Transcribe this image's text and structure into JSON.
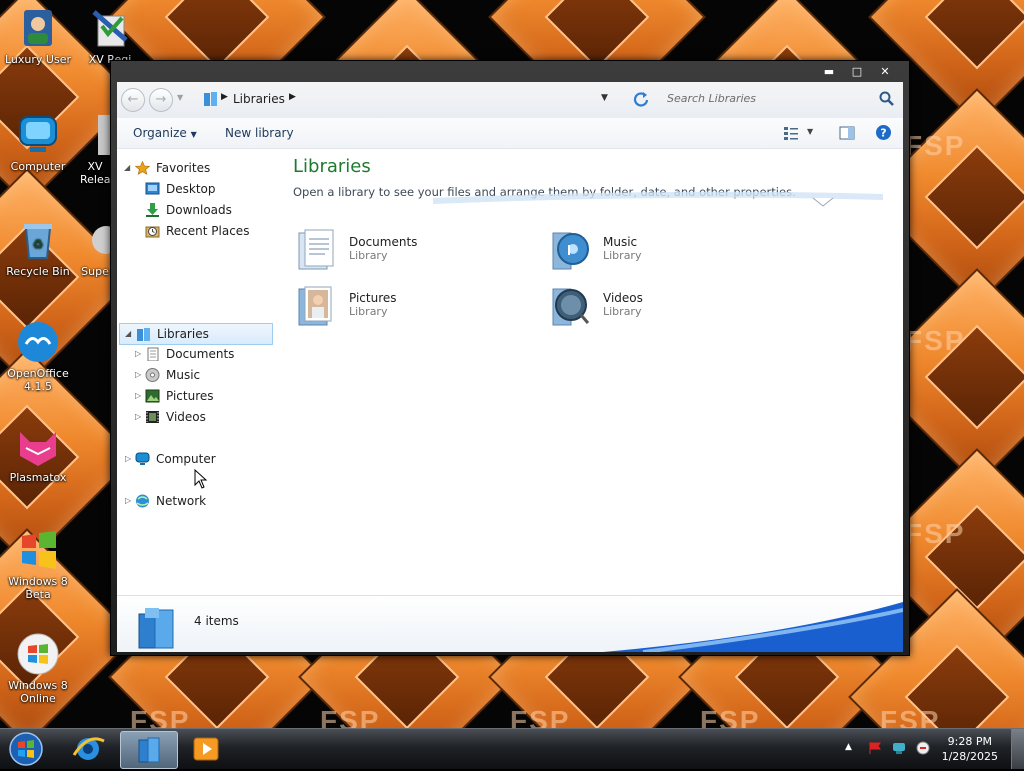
{
  "desktop": {
    "icons": [
      {
        "label": "Luxury User"
      },
      {
        "label": "XV Regi"
      },
      {
        "label": "Computer"
      },
      {
        "label": "XV Relea"
      },
      {
        "label": "Recycle Bin"
      },
      {
        "label": "Supe"
      },
      {
        "label": "OpenOffice 4.1.5"
      },
      {
        "label": "Plasmatox"
      },
      {
        "label": "Windows 8 Beta"
      },
      {
        "label": "Windows 8 Online"
      }
    ],
    "watermark": "FSP"
  },
  "window": {
    "controls": {
      "minimize": "▬",
      "maximize": "□",
      "close": "✕"
    },
    "address": {
      "back": "←",
      "forward": "→",
      "breadcrumb": "Libraries",
      "search_placeholder": "Search Libraries"
    },
    "toolbar": {
      "organize": "Organize",
      "new_library": "New library"
    },
    "nav": {
      "favorites": {
        "label": "Favorites",
        "items": [
          "Desktop",
          "Downloads",
          "Recent Places"
        ]
      },
      "libraries": {
        "label": "Libraries",
        "items": [
          "Documents",
          "Music",
          "Pictures",
          "Videos"
        ]
      },
      "computer": "Computer",
      "network": "Network"
    },
    "main": {
      "title": "Libraries",
      "subtitle": "Open a library to see your files and arrange them by folder, date, and other properties.",
      "items": [
        {
          "name": "Documents",
          "type": "Library"
        },
        {
          "name": "Music",
          "type": "Library"
        },
        {
          "name": "Pictures",
          "type": "Library"
        },
        {
          "name": "Videos",
          "type": "Library"
        }
      ]
    },
    "status": {
      "count": "4 items"
    }
  },
  "taskbar": {
    "time": "9:28 PM",
    "date": "1/28/2025"
  },
  "colors": {
    "accent_green": "#1e7a2e",
    "selection": "#d9ebfb",
    "wallpaper_orange": "#f08a2e"
  }
}
